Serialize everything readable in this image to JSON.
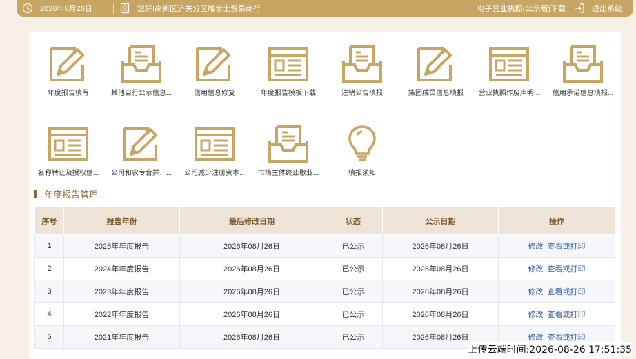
{
  "topbar": {
    "date": "2026年8月26日",
    "greeting": "您好!高新区济关分区睢合士贸易商行",
    "license_download": "电子营业执照(公示版)下载",
    "logout": "退出系统"
  },
  "colors": {
    "gold": "#c9a564",
    "header_bg": "#ede3d6",
    "link": "#3a5fa8",
    "page_bg": "#f6f0e6"
  },
  "tiles": [
    {
      "label": "年度报告填写",
      "icon": "pencil-document-icon"
    },
    {
      "label": "其他自行公示信息...",
      "icon": "inbox-tray-icon"
    },
    {
      "label": "信用信息修复",
      "icon": "pencil-document-icon"
    },
    {
      "label": "年度报告模板下载",
      "icon": "form-template-icon"
    },
    {
      "label": "注销公告填报",
      "icon": "inbox-tray-icon"
    },
    {
      "label": "集团成员信息填报",
      "icon": "pencil-document-icon"
    },
    {
      "label": "营业执照作废声明...",
      "icon": "form-template-icon"
    },
    {
      "label": "信用承诺信息填报...",
      "icon": "inbox-tray-icon"
    },
    {
      "label": "名称转让及授权信...",
      "icon": "form-template-icon"
    },
    {
      "label": "公司和农专合并、...",
      "icon": "pencil-document-icon"
    },
    {
      "label": "公司减少注册资本...",
      "icon": "form-template-icon"
    },
    {
      "label": "市场主体终止歇业...",
      "icon": "inbox-tray-icon"
    },
    {
      "label": "填报须知",
      "icon": "lightbulb-icon"
    }
  ],
  "section": {
    "title": "年度报告管理"
  },
  "table": {
    "headers": [
      "序号",
      "报告年份",
      "最后修改日期",
      "状态",
      "公示日期",
      "操作"
    ],
    "rows": [
      {
        "no": "1",
        "year": "2025年年度报告",
        "modified": "2026年08月26日",
        "status": "已公示",
        "published": "2026年08月26日"
      },
      {
        "no": "2",
        "year": "2024年年度报告",
        "modified": "2026年08月26日",
        "status": "已公示",
        "published": "2026年08月26日"
      },
      {
        "no": "3",
        "year": "2023年年度报告",
        "modified": "2026年08月26日",
        "status": "已公示",
        "published": "2026年08月26日"
      },
      {
        "no": "4",
        "year": "2022年年度报告",
        "modified": "2026年08月26日",
        "status": "已公示",
        "published": "2026年08月26日"
      },
      {
        "no": "5",
        "year": "2021年年度报告",
        "modified": "2026年08月26日",
        "status": "已公示",
        "published": "2026年08月26日"
      }
    ],
    "edit_label": "修改",
    "view_label": "查看或打印"
  },
  "upload_stamp": "上传云端时间:2026-08-26 17:51:35"
}
